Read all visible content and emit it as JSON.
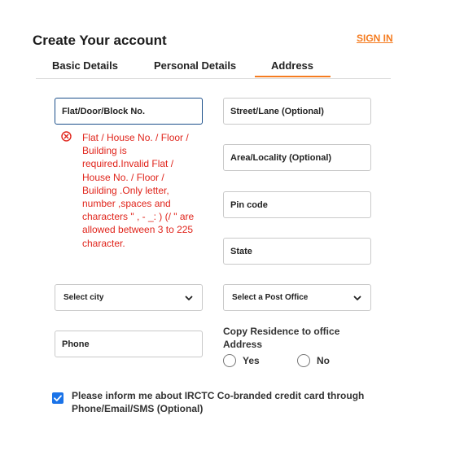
{
  "header": {
    "title": "Create Your account",
    "signin_label": "SIGN IN"
  },
  "tabs": [
    {
      "label": "Basic Details",
      "active": false
    },
    {
      "label": "Personal Details",
      "active": false
    },
    {
      "label": "Address",
      "active": true
    }
  ],
  "form": {
    "flat_placeholder": "Flat/Door/Block No.",
    "error_message": "Flat / House No. / Floor / Building is required.Invalid Flat / House No. / Floor / Building .Only letter, number ,spaces and characters \" , - _: ) (/ \" are allowed between 3 to 225 character.",
    "street_placeholder": "Street/Lane (Optional)",
    "area_placeholder": "Area/Locality (Optional)",
    "pincode_placeholder": "Pin code",
    "state_placeholder": "State",
    "city_select": "Select city",
    "post_office_select": "Select a Post Office",
    "phone_placeholder": "Phone",
    "copy_residence_label": "Copy Residence to office Address",
    "radio_yes": "Yes",
    "radio_no": "No",
    "consent_checked": true,
    "consent_label": "Please inform me about IRCTC Co-branded credit card through Phone/Email/SMS (Optional)"
  },
  "colors": {
    "accent": "#f57c20",
    "error": "#e0241b",
    "focus_border": "#1b4f8a",
    "checkbox": "#1a73e8"
  }
}
